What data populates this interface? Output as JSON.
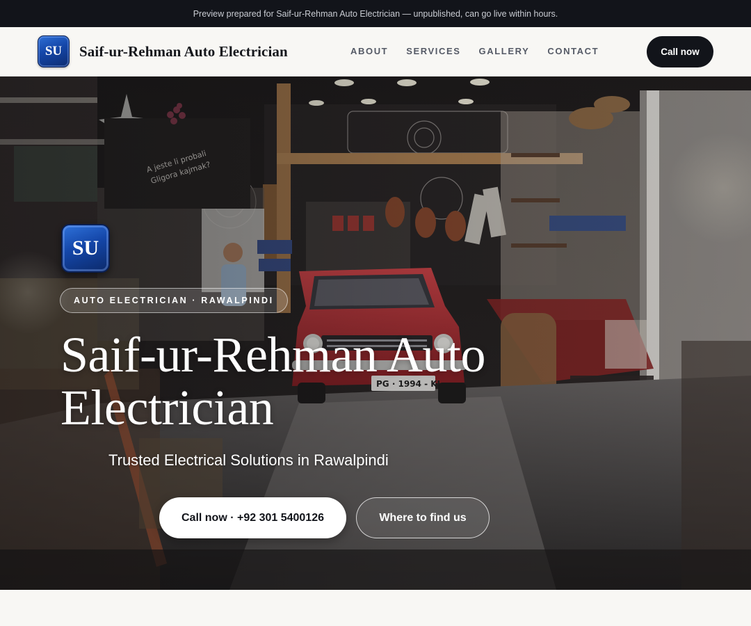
{
  "preview_banner": {
    "text": "Preview prepared for Saif-ur-Rehman Auto Electrician — unpublished, can go live within hours."
  },
  "header": {
    "logo_initials": "SU",
    "brand_name": "Saif-ur-Rehman Auto Electrician",
    "nav": [
      {
        "label": "ABOUT"
      },
      {
        "label": "SERVICES"
      },
      {
        "label": "GALLERY"
      },
      {
        "label": "CONTACT"
      }
    ],
    "cta_label": "Call now"
  },
  "hero": {
    "logo_initials": "SU",
    "tag": "AUTO ELECTRICIAN · RAWALPINDI",
    "title": "Saif-ur-Rehman Auto Electrician",
    "subtitle": "Trusted Electrical Solutions in Rawalpindi",
    "primary_button": "Call now · +92 301 5400126",
    "secondary_button": "Where to find us",
    "background_image": "shop-interior-with-red-car-photo"
  },
  "colors": {
    "dark": "#12141a",
    "page_bg": "#f8f7f4",
    "logo_blue": "#1446a8",
    "white": "#ffffff"
  }
}
